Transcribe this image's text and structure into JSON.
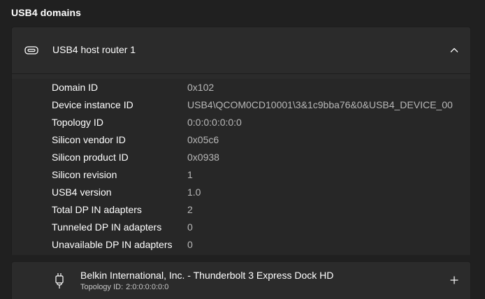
{
  "section": {
    "title": "USB4 domains"
  },
  "router": {
    "title": "USB4 host router 1",
    "icon": "usb-c-port-icon",
    "expand_icon": "chevron-up-icon",
    "properties": [
      {
        "key": "Domain ID",
        "value": "0x102"
      },
      {
        "key": "Device instance ID",
        "value": "USB4\\QCOM0CD10001\\3&1c9bba76&0&USB4_DEVICE_00"
      },
      {
        "key": "Topology ID",
        "value": "0:0:0:0:0:0:0"
      },
      {
        "key": "Silicon vendor ID",
        "value": "0x05c6"
      },
      {
        "key": "Silicon product ID",
        "value": "0x0938"
      },
      {
        "key": "Silicon revision",
        "value": "1"
      },
      {
        "key": "USB4 version",
        "value": "1.0"
      },
      {
        "key": "Total DP IN adapters",
        "value": "2"
      },
      {
        "key": "Tunneled DP IN adapters",
        "value": "0"
      },
      {
        "key": "Unavailable DP IN adapters",
        "value": "0"
      }
    ]
  },
  "device": {
    "name": "Belkin International, Inc. - Thunderbolt 3 Express Dock HD",
    "topology_label": "Topology ID:",
    "topology_value": "2:0:0:0:0:0:0",
    "icon": "usb-plug-icon",
    "expand_icon": "plus-icon"
  },
  "colors": {
    "background": "#202020",
    "card": "#2b2b2b",
    "details": "#272727",
    "value_text": "#b8b8b8"
  }
}
